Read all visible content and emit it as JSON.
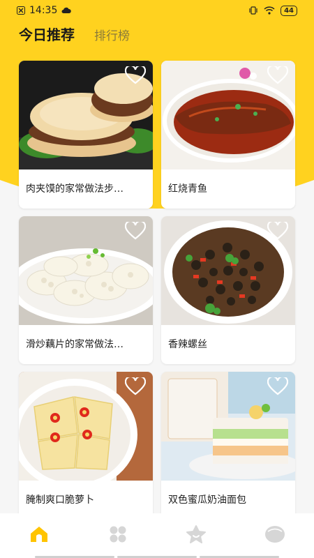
{
  "status_bar": {
    "time": "14:35",
    "battery": "44"
  },
  "tabs": {
    "today": "今日推荐",
    "ranking": "排行榜"
  },
  "recipes": [
    {
      "title": "肉夹馍的家常做法步…"
    },
    {
      "title": "红烧青鱼"
    },
    {
      "title": "滑炒藕片的家常做法…"
    },
    {
      "title": "香辣螺丝"
    },
    {
      "title": "腌制爽口脆萝卜"
    },
    {
      "title": "双色蜜瓜奶油面包"
    }
  ],
  "bottom_nav": {
    "items": [
      "home-icon",
      "category-grid-icon",
      "star-icon",
      "profile-icon"
    ],
    "active_index": 0
  },
  "colors": {
    "brand_yellow": "#ffd21f",
    "active_nav": "#ffc400",
    "inactive_nav": "#d6d6d6"
  }
}
